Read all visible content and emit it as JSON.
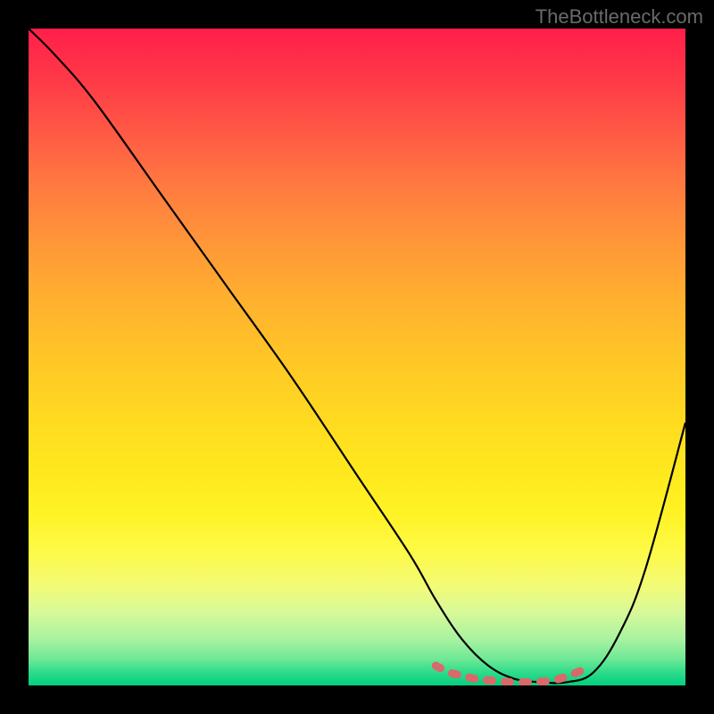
{
  "watermark": "TheBottleneck.com",
  "chart_data": {
    "type": "line",
    "title": "",
    "xlabel": "",
    "ylabel": "",
    "xlim": [
      0,
      100
    ],
    "ylim": [
      0,
      100
    ],
    "series": [
      {
        "name": "bottleneck-curve",
        "x": [
          0,
          4,
          10,
          20,
          30,
          40,
          50,
          58,
          62,
          66,
          70,
          74,
          78,
          82,
          86,
          90,
          94,
          100
        ],
        "y": [
          100,
          96,
          89,
          75,
          61,
          47,
          32,
          20,
          13,
          7,
          3,
          1,
          0.5,
          0.5,
          2,
          8,
          18,
          40
        ]
      },
      {
        "name": "optimal-zone-marker",
        "x": [
          62,
          64,
          66,
          68,
          70,
          72,
          74,
          76,
          78,
          80,
          82,
          84
        ],
        "y": [
          3,
          2,
          1.5,
          1,
          0.8,
          0.6,
          0.5,
          0.5,
          0.6,
          0.8,
          1.4,
          2.2
        ]
      }
    ],
    "colors": {
      "curve": "#000000",
      "marker": "#d86a6a",
      "gradient_top": "#ff1e4a",
      "gradient_mid": "#ffe91e",
      "gradient_bottom": "#00d080"
    }
  }
}
